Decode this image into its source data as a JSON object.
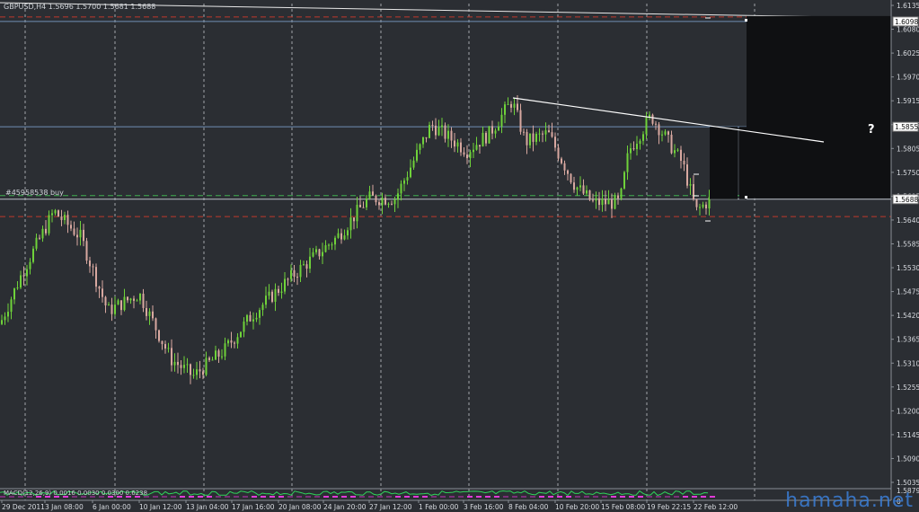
{
  "chart_header": {
    "symbol_ohlc": "GBPUSD,H4  1.5696 1.5700 1.5681 1.5688"
  },
  "order_label": "#45958538 buy",
  "indicator_text": "MACD(12,26,9) 0.0016 0.0030 0.0300 0.6238",
  "question_mark": "?",
  "watermark": "hamaha.net",
  "colors": {
    "background": "#2b2e33",
    "grid": "#c8ccd2",
    "bull_candle": "#6fd23a",
    "bear_candle": "#d8a8a0",
    "red_dash": "#c0392b",
    "green_dash": "#3fae4f",
    "blue_line": "#6f8fb4",
    "dark_box": "#0f1012",
    "indicator_green": "#2fd35a",
    "indicator_magenta": "#e03ad8"
  },
  "price_axis": {
    "labels": [
      "1.6135",
      "1.6080",
      "1.6025",
      "1.5970",
      "1.5915",
      "1.5855",
      "1.5805",
      "1.5750",
      "1.5695",
      "1.5640",
      "1.5585",
      "1.5530",
      "1.5475",
      "1.5420",
      "1.5365",
      "1.5310",
      "1.5255",
      "1.5200",
      "1.5145",
      "1.5090",
      "1.5035",
      "1.5879",
      "0"
    ],
    "tags": [
      {
        "text": "1.6098",
        "level": 1.6098
      },
      {
        "text": "1.5855",
        "level": 1.5855
      },
      {
        "text": "1.5688",
        "level": 1.5688
      }
    ]
  },
  "time_axis": {
    "labels": [
      "29 Dec 2011",
      "3 Jan 08:00",
      "6 Jan 00:00",
      "10 Jan 12:00",
      "13 Jan 04:00",
      "17 Jan 16:00",
      "20 Jan 08:00",
      "24 Jan 20:00",
      "27 Jan 12:00",
      "1 Feb 00:00",
      "3 Feb 16:00",
      "8 Feb 04:00",
      "10 Feb 20:00",
      "15 Feb 08:00",
      "19 Feb 22:15",
      "22 Feb 12:00"
    ]
  },
  "chart_data": {
    "type": "candlestick",
    "title": "GBPUSD,H4",
    "ylim": [
      1.5015,
      1.6145
    ],
    "horizontal_levels": [
      1.6098,
      1.5855,
      1.5688,
      1.5648
    ],
    "trendline": {
      "from": [
        1.5933
      ],
      "to": [
        1.5818
      ]
    }
  }
}
